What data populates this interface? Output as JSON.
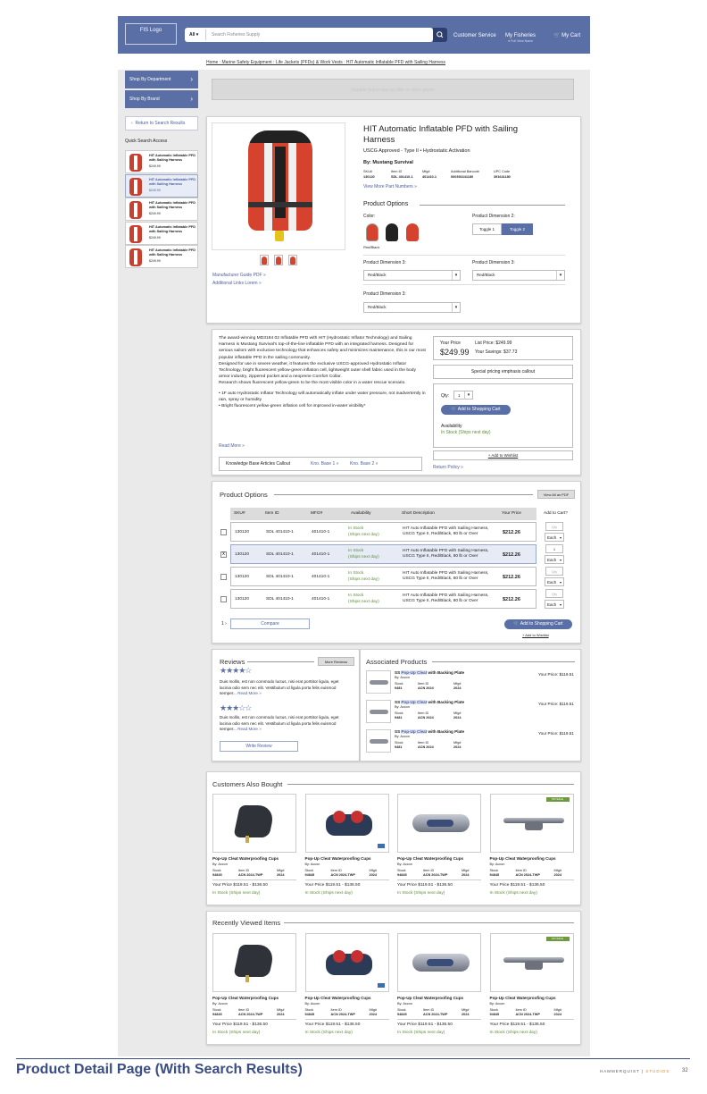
{
  "header": {
    "logo": "FIS Logo",
    "search_scope": "All",
    "search_placeholder": "Search Fisheries Supply",
    "customer_service": "Customer Service",
    "my_fisheries": "My Fisheries",
    "my_fisheries_sub": "Full View Name",
    "cart": "My Cart"
  },
  "breadcrumb": "Home : Marine Safety Equipment : Life Jackets (PFDs) & Work Vests : HIT Automatic Inflatable PFD with Sailing Harness",
  "sidebar": {
    "shop_dept": "Shop By Department",
    "shop_brand": "Shop By Brand",
    "return": "Return to Search Results",
    "quick_title": "Quick Search Access",
    "items": [
      {
        "title": "HIT Automatic Inflatable PFD with Sailing Harness",
        "price": "$249.99"
      },
      {
        "title": "HIT Automatic Inflatable PFD with Sailing Harness",
        "price": "$249.99"
      },
      {
        "title": "HIT Automatic Inflatable PFD with Sailing Harness",
        "price": "$249.99"
      },
      {
        "title": "HIT Automatic Inflatable PFD with Sailing Harness",
        "price": "$249.99"
      },
      {
        "title": "HIT Automatic Inflatable PFD with Sailing Harness",
        "price": "$249.99"
      }
    ]
  },
  "promo": "Variable brand special offer or other promo",
  "product": {
    "title": "HIT Automatic Inflatable PFD with Sailing Harness",
    "subtitle": "USCG Approved - Type II • Hydrostatic Activation",
    "brand": "By: Mustang Survival",
    "codes": [
      {
        "label": "SKU#",
        "value": "130120"
      },
      {
        "label": "Item ID",
        "value": "SDL 401410-1"
      },
      {
        "label": "Mfg#",
        "value": "401410-1"
      },
      {
        "label": "Additional Barcode",
        "value": "000391641180"
      },
      {
        "label": "UPC Code",
        "value": "391641180"
      }
    ],
    "more_parts": "View More Part Numbers",
    "options_title": "Product Options",
    "color_label": "Color:",
    "color_value": "Red/Black",
    "dim2_label": "Product Dimension 2:",
    "toggle1": "Toggle 1",
    "toggle2": "Toggle 2",
    "dim3a_label": "Product Dimension 3:",
    "dim3a_value": "Red/Black",
    "dim3b_label": "Product Dimension 3:",
    "dim3b_value": "Red/Black",
    "dim3c_label": "Product Dimension 3:",
    "dim3c_value": "Red/Black",
    "guide": "Manufacturer Guide PDF",
    "links": "Additional Links Lorem"
  },
  "description": {
    "p1": "The award-winning MD3184 02 Inflatable PFD with HIT (Hydrostatic Inflator Technology) and Sailing Harness is Mustang Survival's top-of-the-line inflatable PFD with an integrated harness. Designed for serious sailors with exclusive technology that enhances safety and minimizes maintenance, this is our most popular inflatable PFD in the sailing community.",
    "p2": "Designed for use in severe weather, it features the exclusive USCG-approved Hydrostatic Inflator Technology, bright fluorescent yellow-green inflation cell, lightweight outer shell fabric used in the body armor industry, zippered pocket and a neoprene Comfort Collar.",
    "p3": "Research shows fluorescent yellow-green to be the most visible color in a water rescue scenario.",
    "b1": "• 1F auto Hydrostatic Inflator Technology will automatically inflate under water pressure, not inadvertently in rain, spray or humidity",
    "b2": "• Bright fluorescent yellow-green inflation cell for improved in-water visibility*",
    "read_more": "Read More",
    "kb_label": "Knowledge Base Articles Callout",
    "kb1": "Kno. Base 1",
    "kb2": "Kno. Base 2"
  },
  "pricebox": {
    "your_price_label": "Your Price",
    "your_price": "$249.99",
    "list_price": "List Price: $249.99",
    "savings": "Your Savings: $37.73",
    "callout": "Special pricing emphasis callout",
    "qty_label": "Qty:",
    "qty": "1",
    "add_cart": "Add to Shopping Cart",
    "availability": "Availability",
    "stock": "In Stock (Ships next day)",
    "wishlist": "+ Add to Wishlist",
    "return_policy": "Return Policy"
  },
  "options_table": {
    "title": "Product Options",
    "view_pdf": "View All as PDF",
    "headers": [
      "SKU#",
      "Item ID",
      "MFG#",
      "Availability",
      "Short Description",
      "Your Price",
      "Add to Cart?"
    ],
    "rows": [
      {
        "sku": "130120",
        "item": "SDL 401410-1",
        "mfg": "401410-1",
        "avail": "In Stock",
        "avail2": "(Ships next day)",
        "desc": "HIT Auto Inflatable PFD with Sailing Harness, USCG Type II, Red/Black, 80 lb or Over",
        "price": "$212.26",
        "qty": "Qty",
        "unit": "Each",
        "checked": ""
      },
      {
        "sku": "130120",
        "item": "SDL 401410-1",
        "mfg": "401410-1",
        "avail": "In Stock",
        "avail2": "(Ships next day)",
        "desc": "HIT Auto Inflatable PFD with Sailing Harness, USCG Type II, Red/Black, 80 lb or Over",
        "price": "$212.26",
        "qty": "1",
        "unit": "Each",
        "checked": "x"
      },
      {
        "sku": "130120",
        "item": "SDL 401410-1",
        "mfg": "401410-1",
        "avail": "In Stock",
        "avail2": "(Ships next day)",
        "desc": "HIT Auto Inflatable PFD with Sailing Harness, USCG Type II, Red/Black, 80 lb or Over",
        "price": "$212.26",
        "qty": "Qty",
        "unit": "Each",
        "checked": ""
      },
      {
        "sku": "130120",
        "item": "SDL 401410-1",
        "mfg": "401410-1",
        "avail": "In Stock",
        "avail2": "(Ships next day)",
        "desc": "HIT Auto Inflatable PFD with Sailing Harness, USCG Type II, Red/Black, 80 lb or Over",
        "price": "$212.26",
        "qty": "Qty",
        "unit": "Each",
        "checked": ""
      }
    ],
    "selected_count": "1",
    "compare": "Compare",
    "add_cart": "Add to Shopping Cart",
    "wishlist": "+ Add to Wishlist"
  },
  "reviews": {
    "title": "Reviews",
    "more": "More Reviews",
    "text": "Duis mollis, est non commodo luctus, nisi erat porttitor ligula, eget lacinia odio sem nec elit. Vestibulum id ligula porta felis euismod semper...",
    "read_more": "Read More",
    "write": "Write Review"
  },
  "associated": {
    "title": "Associated Products",
    "items": [
      {
        "pre": "SS ",
        "link": "Pop-Up Cleat",
        "post": " with Backing Plate",
        "brand": "By: Accon",
        "l1": "Stock",
        "v1": "9481",
        "l2": "Item ID",
        "v2": "ACN 2024",
        "l3": "Mfg#",
        "v3": "2024",
        "price": "Your Price: $119.51"
      },
      {
        "pre": "SS ",
        "link": "Pop-Up Cleat",
        "post": " with Backing Plate",
        "brand": "By: Accon",
        "l1": "Stock",
        "v1": "9481",
        "l2": "Item ID",
        "v2": "ACN 2024",
        "l3": "Mfg#",
        "v3": "2024",
        "price": "Your Price: $119.51"
      },
      {
        "pre": "SS ",
        "link": "Pop-Up Cleat",
        "post": " with Backing Plate",
        "brand": "By: Accon",
        "l1": "Stock",
        "v1": "9481",
        "l2": "Item ID",
        "v2": "ACN 2024",
        "l3": "Mfg#",
        "v3": "2024",
        "price": "Your Price: $119.51"
      }
    ]
  },
  "also_bought": {
    "title": "Customers Also Bought",
    "items": [
      {
        "title": "Pop-Up Cleat Waterproofing Cups",
        "brand": "By: Accon",
        "l1": "Stock",
        "v1": "94845",
        "l2": "Item ID",
        "v2": "ACN 2024-TWP",
        "l3": "Mfg#",
        "v3": "2024",
        "price": "Your Price $119.51 - $136.50",
        "stock": "In Stock (Ships next day)",
        "tag": ""
      },
      {
        "title": "Pop-Up Cleat Waterproofing Cups",
        "brand": "By: Accon",
        "l1": "Stock",
        "v1": "94845",
        "l2": "Item ID",
        "v2": "ACN 2024-TWP",
        "l3": "Mfg#",
        "v3": "2024",
        "price": "Your Price $119.51 - $136.50",
        "stock": "In Stock (Ships next day)",
        "tag": ""
      },
      {
        "title": "Pop-Up Cleat Waterproofing Cups",
        "brand": "By: Accon",
        "l1": "Stock",
        "v1": "94845",
        "l2": "Item ID",
        "v2": "ACN 2024-TWP",
        "l3": "Mfg#",
        "v3": "2024",
        "price": "Your Price $119.51 - $136.50",
        "stock": "In Stock (Ships next day)",
        "tag": ""
      },
      {
        "title": "Pop-Up Cleat Waterproofing Cups",
        "brand": "By: Accon",
        "l1": "Stock",
        "v1": "94845",
        "l2": "Item ID",
        "v2": "ACN 2024-TWP",
        "l3": "Mfg#",
        "v3": "2024",
        "price": "Your Price $119.51 - $136.50",
        "stock": "In Stock (Ships next day)",
        "tag": "ON SALE"
      }
    ]
  },
  "recently_viewed": {
    "title": "Recently Viewed Items",
    "items": [
      {
        "title": "Pop-Up Cleat Waterproofing Cups",
        "brand": "By: Accon",
        "l1": "Stock",
        "v1": "94845",
        "l2": "Item ID",
        "v2": "ACN 2024-TWP",
        "l3": "Mfg#",
        "v3": "2024",
        "price": "Your Price $119.51 - $136.50",
        "stock": "In Stock (Ships next day)",
        "tag": ""
      },
      {
        "title": "Pop-Up Cleat Waterproofing Cups",
        "brand": "By: Accon",
        "l1": "Stock",
        "v1": "94845",
        "l2": "Item ID",
        "v2": "ACN 2024-TWP",
        "l3": "Mfg#",
        "v3": "2024",
        "price": "Your Price $119.51 - $136.50",
        "stock": "In Stock (Ships next day)",
        "tag": ""
      },
      {
        "title": "Pop-Up Cleat Waterproofing Cups",
        "brand": "By: Accon",
        "l1": "Stock",
        "v1": "94845",
        "l2": "Item ID",
        "v2": "ACN 2024-TWP",
        "l3": "Mfg#",
        "v3": "2024",
        "price": "Your Price $119.51 - $136.50",
        "stock": "In Stock (Ships next day)",
        "tag": ""
      },
      {
        "title": "Pop-Up Cleat Waterproofing Cups",
        "brand": "By: Accon",
        "l1": "Stock",
        "v1": "94845",
        "l2": "Item ID",
        "v2": "ACN 2024-TWP",
        "l3": "Mfg#",
        "v3": "2024",
        "price": "Your Price $119.51 - $136.50",
        "stock": "In Stock (Ships next day)",
        "tag": "ON SALE"
      }
    ]
  },
  "footer": {
    "title": "Product Detail Page (With Search Results)",
    "brand": "HAMMERQUIST",
    "brand2": "STUDIOS",
    "page": "32"
  },
  "colors": {
    "primary": "#5a6fa6",
    "dark": "#2e3f6e",
    "stock_green": "#5c8c35",
    "vest_red": "#d5432f"
  }
}
